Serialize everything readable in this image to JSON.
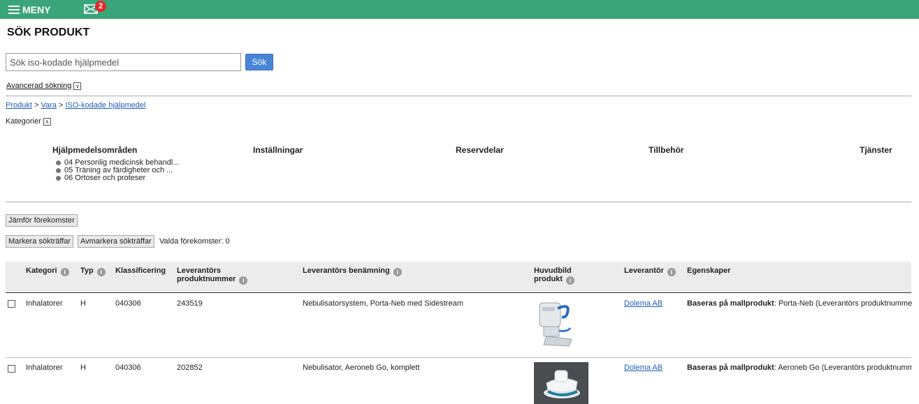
{
  "topbar": {
    "menu_label": "MENY",
    "mail_count": "2",
    "bg": "#3aa57a"
  },
  "page": {
    "title": "SÖK PRODUKT"
  },
  "search": {
    "placeholder": "Sök iso-kodade hjälpmedel",
    "button": "Sök"
  },
  "advanced": {
    "label": "Avancerad sökning"
  },
  "breadcrumb": {
    "item1": "Produkt",
    "sep": ">",
    "item2": "Vara",
    "item3": "ISO-kodade hjälpmedel"
  },
  "categories_toggle": "Kategorier",
  "category_headers": {
    "areas": "Hjälpmedelsområden",
    "settings": "Inställningar",
    "spare_parts": "Reservdelar",
    "accessories": "Tillbehör",
    "services": "Tjänster"
  },
  "areas": [
    "04 Personlig medicinsk behandl...",
    "05 Träning av färdigheter och ...",
    "06 Ortoser och proteser"
  ],
  "actions": {
    "compare": "Jämför förekomster",
    "mark": "Markera sökträffar",
    "unmark": "Avmarkera sökträffar",
    "selected": "Valda förekomster: 0"
  },
  "table": {
    "headers": {
      "category": "Kategori",
      "type": "Typ",
      "classification": "Klassificering",
      "supplier_number_1": "Leverantörs",
      "supplier_number_2": "produktnummer",
      "supplier_name": "Leverantörs benämning",
      "main_image_1": "Huvudbild",
      "main_image_2": "produkt",
      "supplier": "Leverantör",
      "properties": "Egenskaper"
    },
    "rows": [
      {
        "category": "Inhalatorer",
        "type": "H",
        "classification": "040306",
        "supplier_number": "243519",
        "name": "Nebulisatorsystem, Porta-Neb med Sidestream",
        "supplier": "Dolema AB",
        "prop_label": "Baseras på mallprodukt",
        "prop_value": ": Porta-Neb (Leverantörs produktnummer"
      },
      {
        "category": "Inhalatorer",
        "type": "H",
        "classification": "040306",
        "supplier_number": "202852",
        "name": "Nebulisator, Aeroneb Go, komplett",
        "supplier": "Dolema AB",
        "prop_label": "Baseras på mallprodukt",
        "prop_value": ": Aeroneb Go (Leverantörs produktnummer"
      }
    ]
  }
}
